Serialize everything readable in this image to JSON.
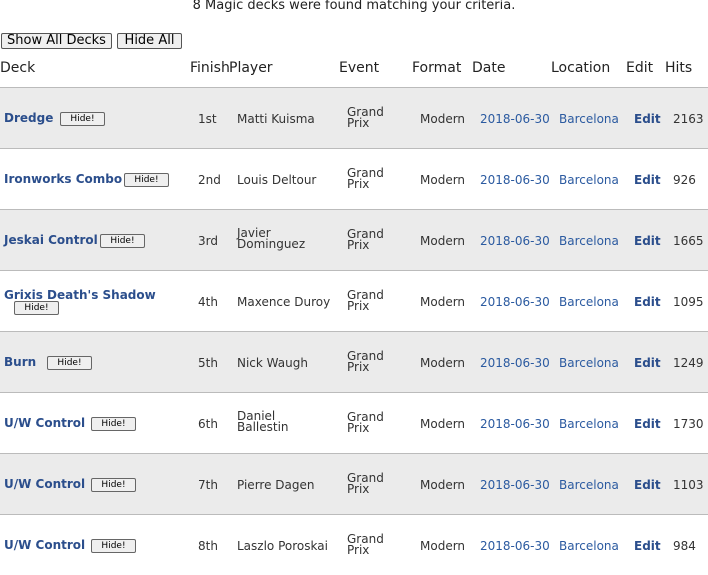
{
  "message": "8 Magic decks were found matching your criteria.",
  "buttons": {
    "show_all": "Show All Decks",
    "hide_all": "Hide All"
  },
  "headers": {
    "deck": "Deck",
    "finish": "Finish",
    "player": "Player",
    "event": "Event",
    "format": "Format",
    "date": "Date",
    "location": "Location",
    "edit": "Edit",
    "hits": "Hits"
  },
  "hide_label": "Hide!",
  "rows": [
    {
      "deck": "Dredge",
      "finish": "1st",
      "player": "Matti Kuisma",
      "event_l1": "Grand",
      "event_l2": "Prix",
      "format": "Modern",
      "date": "2018-06-30",
      "location": "Barcelona",
      "edit": "Edit",
      "hits": "2163"
    },
    {
      "deck": "Ironworks Combo",
      "finish": "2nd",
      "player": "Louis Deltour",
      "event_l1": "Grand",
      "event_l2": "Prix",
      "format": "Modern",
      "date": "2018-06-30",
      "location": "Barcelona",
      "edit": "Edit",
      "hits": "926"
    },
    {
      "deck": "Jeskai Control",
      "finish": "3rd",
      "player": "Javier Dominguez",
      "event_l1": "Grand",
      "event_l2": "Prix",
      "format": "Modern",
      "date": "2018-06-30",
      "location": "Barcelona",
      "edit": "Edit",
      "hits": "1665"
    },
    {
      "deck": "Grixis Death's Shadow",
      "finish": "4th",
      "player": "Maxence Duroy",
      "event_l1": "Grand",
      "event_l2": "Prix",
      "format": "Modern",
      "date": "2018-06-30",
      "location": "Barcelona",
      "edit": "Edit",
      "hits": "1095"
    },
    {
      "deck": "Burn",
      "finish": "5th",
      "player": "Nick Waugh",
      "event_l1": "Grand",
      "event_l2": "Prix",
      "format": "Modern",
      "date": "2018-06-30",
      "location": "Barcelona",
      "edit": "Edit",
      "hits": "1249"
    },
    {
      "deck": "U/W Control",
      "finish": "6th",
      "player": "Daniel Ballestin",
      "event_l1": "Grand",
      "event_l2": "Prix",
      "format": "Modern",
      "date": "2018-06-30",
      "location": "Barcelona",
      "edit": "Edit",
      "hits": "1730"
    },
    {
      "deck": "U/W Control",
      "finish": "7th",
      "player": "Pierre Dagen",
      "event_l1": "Grand",
      "event_l2": "Prix",
      "format": "Modern",
      "date": "2018-06-30",
      "location": "Barcelona",
      "edit": "Edit",
      "hits": "1103"
    },
    {
      "deck": "U/W Control",
      "finish": "8th",
      "player": "Laszlo Poroskai",
      "event_l1": "Grand",
      "event_l2": "Prix",
      "format": "Modern",
      "date": "2018-06-30",
      "location": "Barcelona",
      "edit": "Edit",
      "hits": "984"
    }
  ]
}
